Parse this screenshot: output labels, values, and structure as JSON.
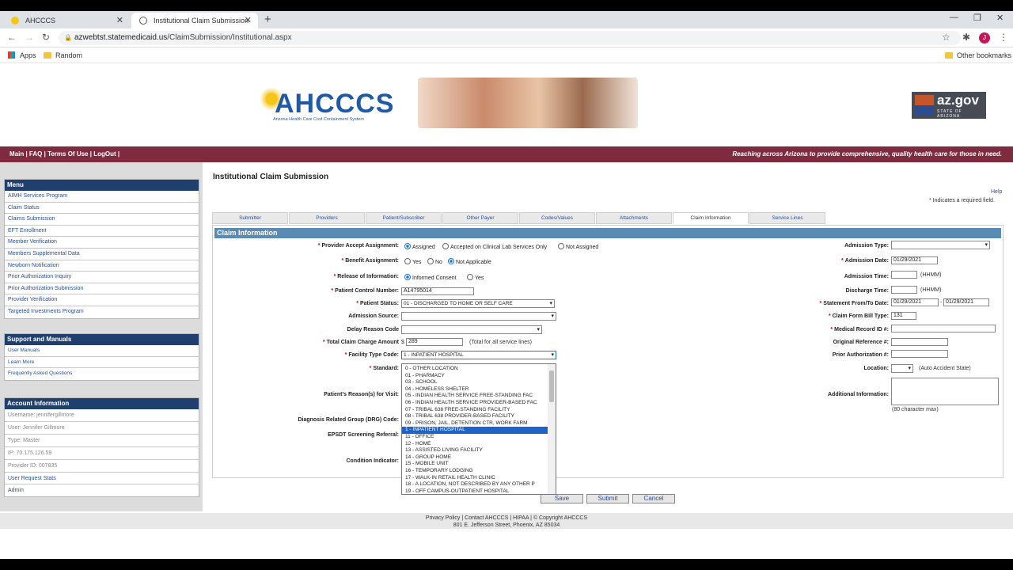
{
  "browser": {
    "tabs": [
      {
        "title": "AHCCCS"
      },
      {
        "title": "Institutional Claim Submission"
      }
    ],
    "url_host": "azwebtst.statemedicaid.us",
    "url_path": "/ClaimSubmission/Institutional.aspx",
    "bookmarks": {
      "apps": "Apps",
      "random": "Random",
      "other": "Other bookmarks"
    },
    "profile_initial": "J"
  },
  "header": {
    "logo_word": "AHCCCS",
    "logo_tagline": "Arizona Health Care Cost Containment System",
    "azgov_title": "az.gov",
    "azgov_sub": "STATE OF ARIZONA"
  },
  "banner": {
    "links": [
      "Main",
      "FAQ",
      "Terms Of Use",
      "LogOut"
    ],
    "tagline": "Reaching across Arizona to provide comprehensive, quality health care for those in need."
  },
  "sidebar": {
    "menu_title": "Menu",
    "menu_items": [
      "AIMH Services Program",
      "Claim Status",
      "Claims Submission",
      "EFT Enrollment",
      "Member Verification",
      "Members Supplemental Data",
      "Newborn Notification",
      "Prior Authorization Inquiry",
      "Prior Authorization Submission",
      "Provider Verification",
      "Targeted Investments Program"
    ],
    "support_title": "Support and Manuals",
    "support_items": [
      "User Manuals",
      "Learn More",
      "Frequently Asked Questions"
    ],
    "account_title": "Account Information",
    "account_items": [
      "Username: jennifergillmore",
      "User: Jennifer Gillmore",
      "Type: Master",
      "IP: 70.175.126.59",
      "Provider ID: 007835"
    ],
    "account_links": [
      "User Request Stats",
      "Admin"
    ]
  },
  "main": {
    "title": "Institutional Claim Submission",
    "help": "Help",
    "required_note": "Indicates a required field.",
    "tabs": [
      "Submitter",
      "Providers",
      "Patient/Subscriber",
      "Other Payer",
      "Codes/Values",
      "Attachments",
      "Claim Information",
      "Service Lines"
    ],
    "section_title": "Claim Information"
  },
  "form": {
    "provider_accept_label": "Provider Accept Assignment:",
    "provider_accept_options": [
      "Assigned",
      "Accepted on Clinical Lab Services Only",
      "Not Assigned"
    ],
    "benefit_label": "Benefit Assignment:",
    "benefit_options": [
      "Yes",
      "No",
      "Not Applicable"
    ],
    "release_label": "Release of Information:",
    "release_options": [
      "Informed Consent",
      "Yes"
    ],
    "patient_control_label": "Patient Control Number:",
    "patient_control_value": "A14795014",
    "patient_status_label": "Patient Status:",
    "patient_status_value": "01 - DISCHARGED TO HOME OR SELF CARE",
    "admission_source_label": "Admission Source:",
    "delay_reason_label": "Delay Reason Code",
    "total_charge_label": "Total Claim Charge Amount",
    "total_charge_currency": "$",
    "total_charge_value": "289",
    "total_charge_note": "(Total for all service lines)",
    "facility_type_label": "Facility Type Code:",
    "facility_type_value": "1 - INPATIENT HOSPITAL",
    "standard_label": "Standard:",
    "reason_visit_label": "Patient's Reason(s) for Visit:",
    "drg_label": "Diagnosis Related Group (DRG) Code:",
    "epsdt_label": "EPSDT Screening Referral:",
    "condition_label": "Condition Indicator:",
    "admission_type_label": "Admission Type:",
    "admission_date_label": "Admission Date:",
    "admission_date_value": "01/29/2021",
    "admission_time_label": "Admission Time:",
    "hhmm": "(HHMM)",
    "discharge_time_label": "Discharge Time:",
    "statement_label": "Statement From/To Date:",
    "statement_from": "01/29/2021",
    "statement_dash": "-",
    "statement_to": "01/29/2021",
    "bill_type_label": "Claim Form Bill Type:",
    "bill_type_value": "131",
    "medical_record_label": "Medical Record ID #:",
    "original_ref_label": "Original Reference #:",
    "prior_auth_label": "Prior Authorization #:",
    "location_label": "Location:",
    "location_note": "(Auto Accident State)",
    "additional_info_label": "Additional Information:",
    "char_max_note": "(80 character max)",
    "buttons": {
      "save": "Save",
      "submit": "Submit",
      "cancel": "Cancel"
    }
  },
  "dropdown_options": [
    "0 - OTHER LOCATION",
    "01 - PHARMACY",
    "03 - SCHOOL",
    "04 - HOMELESS SHELTER",
    "05 - INDIAN HEALTH SERVICE FREE-STANDING FAC",
    "06 - INDIAN HEALTH SERVICE PROVIDER-BASED FAC",
    "07 - TRIBAL 638 FREE-STANDING FACILITY",
    "08 - TRIBAL 638 PROVIDER-BASED FACILITY",
    "09 - PRISON, JAIL, DETENTION CTR, WORK FARM",
    "1 - INPATIENT HOSPITAL",
    "11 - OFFICE",
    "12 - HOME",
    "13 - ASSISTED LIVING FACILITY",
    "14 - GROUP HOME",
    "15 - MOBILE UNIT",
    "16 - TEMPORARY LODGING",
    "17 - WALK-IN RETAIL HEALTH CLINIC",
    "18 - A LOCATION, NOT DESCRIBED BY ANY OTHER P",
    "19 - OFF CAMPUS-OUTPATIENT HOSPITAL"
  ],
  "dropdown_selected_index": 9,
  "footer": {
    "links": [
      "Privacy Policy",
      "Contact AHCCCS",
      "HIPAA",
      "© Copyright AHCCCS"
    ],
    "address": "801 E. Jefferson Street, Phoenix, AZ 85034"
  },
  "colors": {
    "banner": "#7f2a3f",
    "menu_header": "#1f3f6e",
    "section_header": "#5b8ab4",
    "selected_option": "#1e64c8"
  }
}
